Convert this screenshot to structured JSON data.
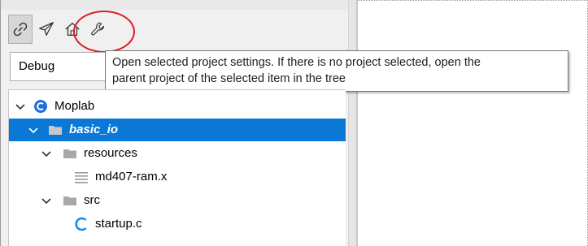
{
  "toolbar": {
    "buttons": [
      {
        "icon": "link-icon",
        "state": "pressed"
      },
      {
        "icon": "paper-plane-icon",
        "state": "normal"
      },
      {
        "icon": "home-icon",
        "state": "normal"
      },
      {
        "icon": "wrench-icon",
        "state": "normal"
      }
    ]
  },
  "config_dropdown": {
    "selected": "Debug"
  },
  "tooltip": {
    "line1": "Open selected project settings. If there is no project selected, open the",
    "line2": "parent project of the selected item in the tree"
  },
  "tree": {
    "root": {
      "label": "Moplab",
      "icon": "project-c-icon",
      "expanded": true
    },
    "items": [
      {
        "label": "basic_io",
        "icon": "folder-icon",
        "expanded": true,
        "selected": true
      },
      {
        "label": "resources",
        "icon": "folder-icon",
        "expanded": true
      },
      {
        "label": "md407-ram.x",
        "icon": "text-file-icon"
      },
      {
        "label": "src",
        "icon": "folder-icon",
        "expanded": true
      },
      {
        "label": "startup.c",
        "icon": "c-file-icon"
      }
    ]
  },
  "colors": {
    "selection": "#0b78d7",
    "annotation_circle": "#e11b22",
    "project_icon": "#1e6fd9",
    "folder": "#a8a8a8",
    "c_file_icon": "#1e88e5"
  }
}
